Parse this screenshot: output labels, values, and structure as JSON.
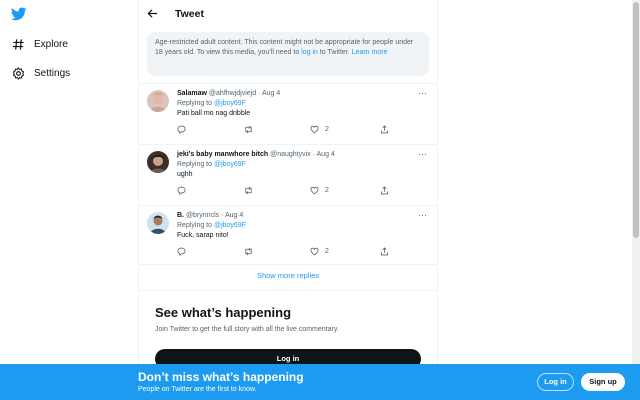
{
  "nav": {
    "logo_icon": "twitter-bird-icon",
    "items": [
      {
        "icon": "hashtag-icon",
        "label": "Explore"
      },
      {
        "icon": "gear-icon",
        "label": "Settings"
      }
    ]
  },
  "header": {
    "title": "Tweet",
    "back_icon": "back-arrow-icon"
  },
  "notice": {
    "text_before": "Age-restricted adult content. This content might not be appropriate for people under 18 years old. To view this media, you’ll need to ",
    "login_link": "log in",
    "text_middle": " to Twitter. ",
    "learn_more": "Learn more"
  },
  "tweets": [
    {
      "name": "Salamaw",
      "handle": "@ahfhwjdjviejd",
      "date": "Aug 4",
      "replying_prefix": "Replying to ",
      "replying_to": "@jboy69F",
      "text": "Pati ball mo nag dribble",
      "likes": "2",
      "avatar_color": "#e8b5a8"
    },
    {
      "name": "jeki's baby manwhore bitch",
      "handle": "@naughtyvix",
      "date": "Aug 4",
      "replying_prefix": "Replying to ",
      "replying_to": "@jboy69F",
      "text": "ughh",
      "likes": "2",
      "avatar_color": "#6b5b4e"
    },
    {
      "name": "B.",
      "handle": "@brynncls",
      "date": "Aug 4",
      "replying_prefix": "Replying to ",
      "replying_to": "@jboy69F",
      "text": "Fuck, sarap nito!",
      "likes": "2",
      "avatar_color": "#9fc3d8"
    }
  ],
  "show_more": "Show more replies",
  "happening": {
    "title": "See what’s happening",
    "subtitle": "Join Twitter to get the full story with all the live commentary.",
    "login": "Log in"
  },
  "bottom_bar": {
    "title": "Don’t miss what’s happening",
    "subtitle": "People on Twitter are the first to know.",
    "login": "Log in",
    "signup": "Sign up"
  },
  "colors": {
    "brand": "#1d9bf0",
    "text": "#0f1419",
    "muted": "#536471"
  }
}
